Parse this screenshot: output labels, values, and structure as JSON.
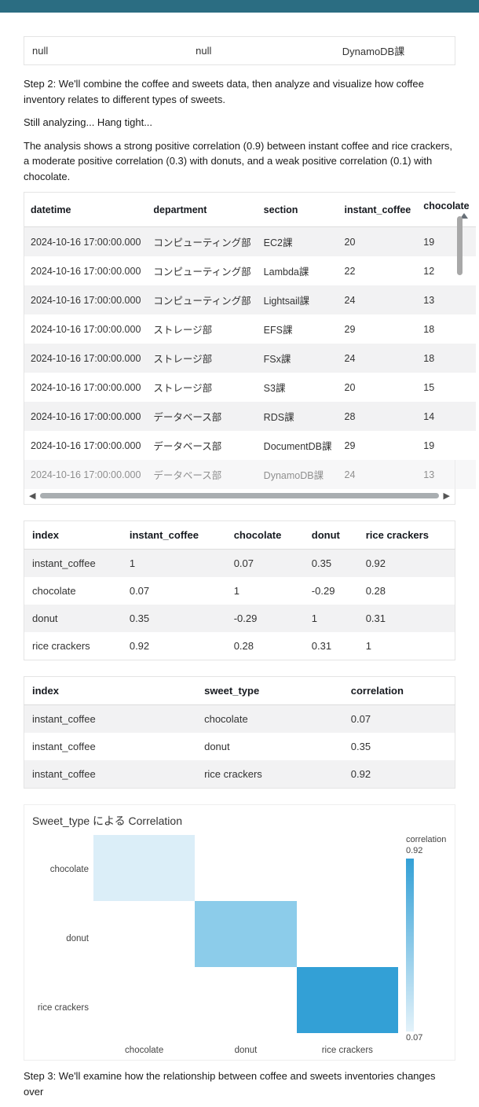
{
  "top_row": {
    "c1": "null",
    "c2": "null",
    "c3": "DynamoDB課"
  },
  "prose1": "Step 2: We'll combine the coffee and sweets data, then analyze and visualize how coffee inventory relates to different types of sweets.",
  "prose2": "Still analyzing... Hang tight...",
  "prose3": "The analysis shows a strong positive correlation (0.9) between instant coffee and rice crackers, a moderate positive correlation (0.3) with donuts, and a weak positive correlation (0.1) with chocolate.",
  "main_table": {
    "headers": [
      "datetime",
      "department",
      "section",
      "instant_coffee",
      "chocolate"
    ],
    "rows": [
      [
        "2024-10-16 17:00:00.000",
        "コンピューティング部",
        "EC2課",
        "20",
        "19"
      ],
      [
        "2024-10-16 17:00:00.000",
        "コンピューティング部",
        "Lambda課",
        "22",
        "12"
      ],
      [
        "2024-10-16 17:00:00.000",
        "コンピューティング部",
        "Lightsail課",
        "24",
        "13"
      ],
      [
        "2024-10-16 17:00:00.000",
        "ストレージ部",
        "EFS課",
        "29",
        "18"
      ],
      [
        "2024-10-16 17:00:00.000",
        "ストレージ部",
        "FSx課",
        "24",
        "18"
      ],
      [
        "2024-10-16 17:00:00.000",
        "ストレージ部",
        "S3課",
        "20",
        "15"
      ],
      [
        "2024-10-16 17:00:00.000",
        "データベース部",
        "RDS課",
        "28",
        "14"
      ],
      [
        "2024-10-16 17:00:00.000",
        "データベース部",
        "DocumentDB課",
        "29",
        "19"
      ]
    ],
    "cutoff": [
      "2024-10-16 17:00:00.000",
      "データベース部",
      "DynamoDB課",
      "24",
      "13"
    ]
  },
  "corr_matrix": {
    "headers": [
      "index",
      "instant_coffee",
      "chocolate",
      "donut",
      "rice crackers"
    ],
    "rows": [
      [
        "instant_coffee",
        "1",
        "0.07",
        "0.35",
        "0.92"
      ],
      [
        "chocolate",
        "0.07",
        "1",
        "-0.29",
        "0.28"
      ],
      [
        "donut",
        "0.35",
        "-0.29",
        "1",
        "0.31"
      ],
      [
        "rice crackers",
        "0.92",
        "0.28",
        "0.31",
        "1"
      ]
    ]
  },
  "corr_list": {
    "headers": [
      "index",
      "sweet_type",
      "correlation"
    ],
    "rows": [
      [
        "instant_coffee",
        "chocolate",
        "0.07"
      ],
      [
        "instant_coffee",
        "donut",
        "0.35"
      ],
      [
        "instant_coffee",
        "rice crackers",
        "0.92"
      ]
    ]
  },
  "chart": {
    "title": "Sweet_type による Correlation",
    "legend_label": "correlation",
    "legend_max": "0.92",
    "legend_min": "0.07",
    "y": [
      "chocolate",
      "donut",
      "rice crackers"
    ],
    "x": [
      "chocolate",
      "donut",
      "rice crackers"
    ]
  },
  "prose4": "Step 3: We'll examine how the relationship between coffee and sweets inventories changes over",
  "chart_data": {
    "type": "heatmap",
    "title": "Sweet_type による Correlation",
    "categories": [
      "chocolate",
      "donut",
      "rice crackers"
    ],
    "matrix_diag_only": true,
    "values": [
      0.07,
      0.35,
      0.92
    ],
    "colorbar_label": "correlation",
    "color_range": [
      0.07,
      0.92
    ]
  }
}
